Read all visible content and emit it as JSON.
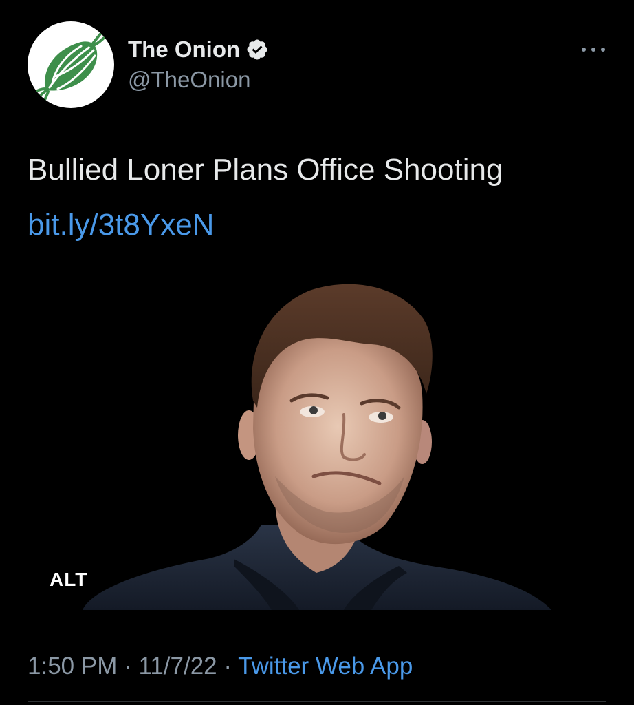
{
  "tweet": {
    "author": {
      "display_name": "The Onion",
      "handle": "@TheOnion",
      "verified": true,
      "avatar_icon": "onion-logo-icon",
      "avatar_color": "#3e8f4b"
    },
    "text": "Bullied Loner Plans Office Shooting",
    "link": "bit.ly/3t8YxeN",
    "media": {
      "alt_badge": "ALT"
    },
    "meta": {
      "time": "1:50 PM",
      "separator1": " · ",
      "date": "11/7/22",
      "separator2": " · ",
      "source": "Twitter Web App"
    },
    "more_icon": "more-horizontal-icon"
  },
  "colors": {
    "background": "#000000",
    "text_primary": "#e7e9ea",
    "text_secondary": "#8b98a5",
    "link": "#4a99e9",
    "verified_badge": "#e7e9ea"
  }
}
